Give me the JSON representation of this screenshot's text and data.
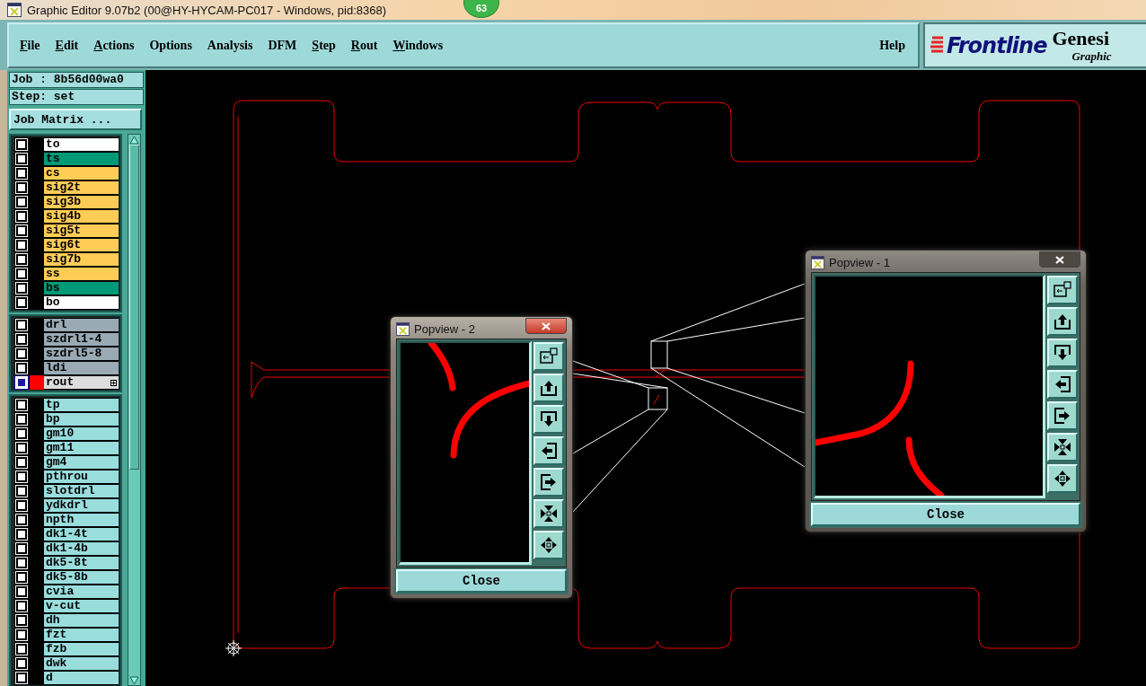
{
  "window": {
    "title": "Graphic Editor 9.07b2 (00@HY-HYCAM-PC017 - Windows, pid:8368)"
  },
  "badge": "63",
  "menu": [
    {
      "label": "File",
      "underlined": true
    },
    {
      "label": "Edit",
      "underlined": true
    },
    {
      "label": "Actions",
      "underlined": true
    },
    {
      "label": "Options",
      "underlined": false
    },
    {
      "label": "Analysis",
      "underlined": false
    },
    {
      "label": "DFM",
      "underlined": false
    },
    {
      "label": "Step",
      "underlined": true
    },
    {
      "label": "Rout",
      "underlined": true
    },
    {
      "label": "Windows",
      "underlined": true
    }
  ],
  "help": "Help",
  "logo": {
    "brand": "Frontline",
    "product": "Genesi",
    "subtitle": "Graphic"
  },
  "sidebar": {
    "job": "Job : 8b56d00wa0",
    "step": "Step: set",
    "job_matrix": "Job Matrix ...",
    "layer_groups": [
      {
        "layers": [
          {
            "name": "to",
            "color": "#ffffff",
            "selected": false
          },
          {
            "name": "ts",
            "color": "#009977",
            "selected": false
          },
          {
            "name": "cs",
            "color": "#ffcc55",
            "selected": false
          },
          {
            "name": "sig2t",
            "color": "#ffcc55",
            "selected": false
          },
          {
            "name": "sig3b",
            "color": "#ffcc55",
            "selected": false
          },
          {
            "name": "sig4b",
            "color": "#ffcc55",
            "selected": false
          },
          {
            "name": "sig5t",
            "color": "#ffcc55",
            "selected": false
          },
          {
            "name": "sig6t",
            "color": "#ffcc55",
            "selected": false
          },
          {
            "name": "sig7b",
            "color": "#ffcc55",
            "selected": false
          },
          {
            "name": "ss",
            "color": "#ffcc55",
            "selected": false
          },
          {
            "name": "bs",
            "color": "#009977",
            "selected": false
          },
          {
            "name": "bo",
            "color": "#ffffff",
            "selected": false
          }
        ]
      },
      {
        "layers": [
          {
            "name": "drl",
            "color": "#99aab4",
            "selected": false
          },
          {
            "name": "szdrl1-4",
            "color": "#99aab4",
            "selected": false
          },
          {
            "name": "szdrl5-8",
            "color": "#99aab4",
            "selected": false
          },
          {
            "name": "ldi",
            "color": "#99aab4",
            "selected": false
          },
          {
            "name": "rout",
            "color": "#dddddd",
            "selected": true
          }
        ]
      },
      {
        "layers": [
          {
            "name": "tp",
            "color": "#99dddd",
            "selected": false
          },
          {
            "name": "bp",
            "color": "#99dddd",
            "selected": false
          },
          {
            "name": "gm10",
            "color": "#99dddd",
            "selected": false
          },
          {
            "name": "gm11",
            "color": "#99dddd",
            "selected": false
          },
          {
            "name": "gm4",
            "color": "#99dddd",
            "selected": false
          },
          {
            "name": "pthrou",
            "color": "#99dddd",
            "selected": false
          },
          {
            "name": "slotdrl",
            "color": "#99dddd",
            "selected": false
          },
          {
            "name": "ydkdrl",
            "color": "#99dddd",
            "selected": false
          },
          {
            "name": "npth",
            "color": "#99dddd",
            "selected": false
          },
          {
            "name": "dk1-4t",
            "color": "#99dddd",
            "selected": false
          },
          {
            "name": "dk1-4b",
            "color": "#99dddd",
            "selected": false
          },
          {
            "name": "dk5-8t",
            "color": "#99dddd",
            "selected": false
          },
          {
            "name": "dk5-8b",
            "color": "#99dddd",
            "selected": false
          },
          {
            "name": "cvia",
            "color": "#99dddd",
            "selected": false
          },
          {
            "name": "v-cut",
            "color": "#99dddd",
            "selected": false
          },
          {
            "name": "dh",
            "color": "#99dddd",
            "selected": false
          },
          {
            "name": "fzt",
            "color": "#99dddd",
            "selected": false
          },
          {
            "name": "fzb",
            "color": "#99dddd",
            "selected": false
          },
          {
            "name": "dwk",
            "color": "#99dddd",
            "selected": false
          },
          {
            "name": "d",
            "color": "#99dddd",
            "selected": false
          }
        ]
      }
    ]
  },
  "popviews": [
    {
      "title": "Popview - 1",
      "active": false,
      "close_label": "Close"
    },
    {
      "title": "Popview - 2",
      "active": true,
      "close_label": "Close"
    }
  ]
}
